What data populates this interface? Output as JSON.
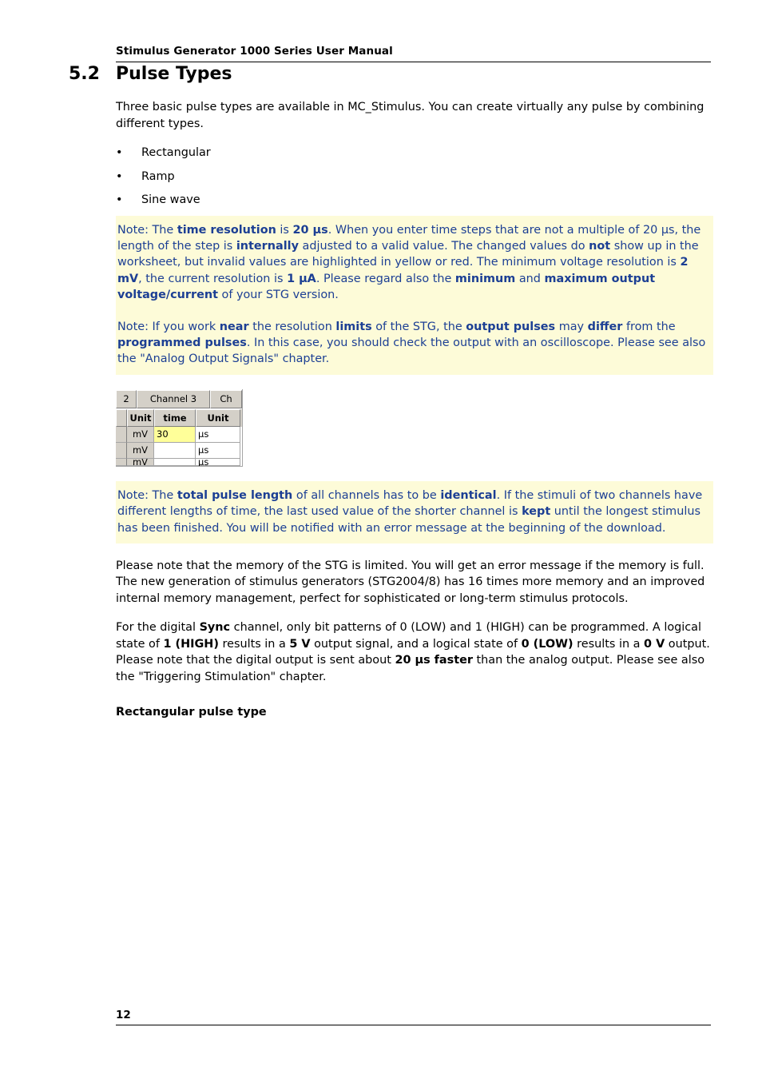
{
  "header": {
    "title": "Stimulus Generator 1000 Series User Manual"
  },
  "section": {
    "number": "5.2",
    "title": "Pulse Types"
  },
  "intro": "Three basic pulse types are available in MC_Stimulus. You can create virtually any pulse by combining different types.",
  "bullets": [
    {
      "marker": "•",
      "label": "Rectangular"
    },
    {
      "marker": "•",
      "label": "Ramp"
    },
    {
      "marker": "•",
      "label": "Sine wave"
    }
  ],
  "notes": {
    "note1": "Note: The time resolution is 20 µs. When you enter time steps that are not a multiple of 20 µs, the length of the step is internally adjusted to a valid value. The changed values do not show up in the worksheet, but invalid values are highlighted in yellow or red. The minimum voltage resolution is 2 mV, the current resolution is 1 µA. Please regard also the minimum and maximum output voltage/current of your STG version.",
    "note2": "Note: If you work near the resolution limits of the STG, the output pulses may differ from the programmed pulses. In this case, you should check the output with an oscilloscope. Please see also the \"Analog Output Signals\" chapter.",
    "note3": "Note: The total pulse length of all channels has to be identical. If the stimuli of two channels have different lengths of time, the last used value of the shorter channel is kept until the longest stimulus has been finished. You will be notified with an error message at the beginning of the download."
  },
  "screenshot": {
    "tabs": [
      "2",
      "Channel 3",
      "Ch"
    ],
    "columns": [
      "",
      "Unit",
      "time",
      "Unit"
    ],
    "rows": [
      {
        "rownum": "",
        "unit1": "mV",
        "time": "30",
        "unit2": "µs",
        "highlight": true
      },
      {
        "rownum": "",
        "unit1": "mV",
        "time": "",
        "unit2": "µs",
        "highlight": false
      },
      {
        "rownum": "",
        "unit1": "mV",
        "time": "",
        "unit2": "µs",
        "highlight": false
      }
    ]
  },
  "paragraphs": {
    "memory": "Please note that the memory of the STG is limited. You will get an error message if the memory is full. The new generation of stimulus generators (STG2004/8) has 16 times more memory and an improved internal memory management, perfect for sophisticated or long-term stimulus protocols.",
    "sync": "For the digital Sync channel, only bit patterns of 0 (LOW) and 1 (HIGH) can be programmed. A logical state of 1 (HIGH) results in a 5 V output signal, and a logical state of 0 (LOW) results in a 0 V output. Please note that the digital output is sent about 20 µs faster than the analog output. Please see also the \"Triggering Stimulation\" chapter."
  },
  "subheading": "Rectangular pulse type",
  "footer": {
    "pageno": "12"
  }
}
